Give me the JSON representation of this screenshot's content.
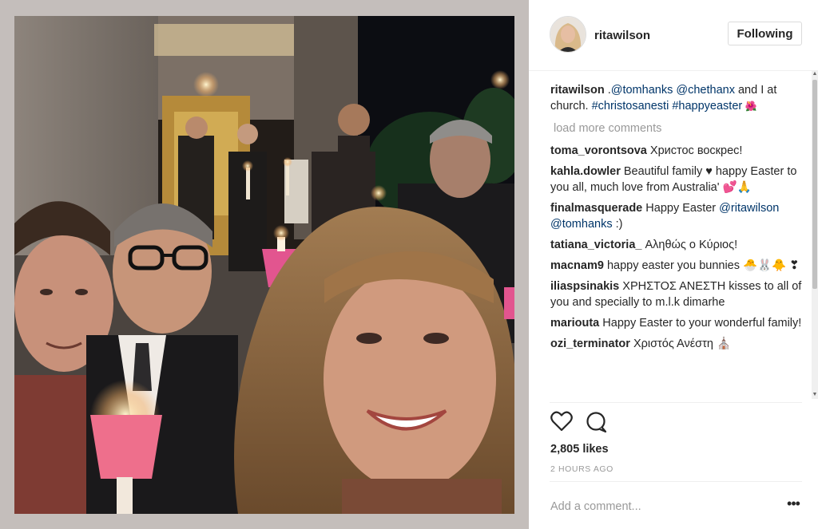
{
  "post": {
    "username": "ritawilson",
    "follow_label": "Following",
    "caption": {
      "user": "ritawilson",
      "parts": [
        " ",
        "@tomhanks",
        " ",
        "@chethanx",
        " and I at church. ",
        "#christosanesti",
        " ",
        "#happyeaster",
        " 🌺"
      ],
      "prefix": "."
    },
    "load_more": "load more comments",
    "comments": [
      {
        "user": "toma_vorontsova",
        "text": "Христос воскрес!"
      },
      {
        "user": "kahla.dowler",
        "text": "Beautiful family ♥ happy Easter to you all, much love from Australia' 💕🙏"
      },
      {
        "user": "finalmasquerade",
        "text": "Happy Easter ",
        "mention": "@ritawilson @tomhanks",
        "tail": " :)"
      },
      {
        "user": "tatiana_victoria_",
        "text": "Αληθώς ο Κύριος!"
      },
      {
        "user": "macnam9",
        "text": "happy easter you bunnies 🐣🐰🐥 ❣"
      },
      {
        "user": "iliaspsinakis",
        "text": "ΧΡΗΣΤΟΣ ΑΝΕΣΤΗ kisses to all of you and specially to m.l.k dimarhe"
      },
      {
        "user": "mariouta",
        "text": "Happy Easter to your wonderful family!"
      },
      {
        "user": "ozi_terminator",
        "text": "Χριστός Ανέστη ⛪"
      }
    ],
    "likes": "2,805 likes",
    "time": "2 HOURS AGO",
    "add_comment_placeholder": "Add a comment...",
    "more_label": "•••"
  },
  "icons": {
    "like": "heart-icon",
    "comment": "comment-bubble-icon",
    "more": "more-options-icon"
  },
  "colors": {
    "mention": "#003569",
    "muted": "#999999",
    "text": "#262626"
  }
}
